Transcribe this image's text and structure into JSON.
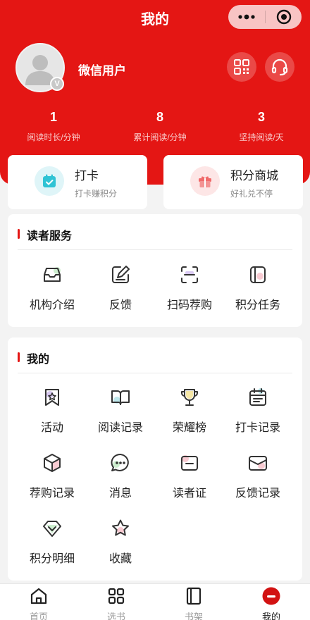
{
  "header": {
    "title": "我的"
  },
  "profile": {
    "username": "微信用户",
    "badge": "V"
  },
  "stats": [
    {
      "value": "1",
      "label": "阅读时长/分钟"
    },
    {
      "value": "8",
      "label": "累计阅读/分钟"
    },
    {
      "value": "3",
      "label": "坚持阅读/天"
    }
  ],
  "quick": {
    "checkin": {
      "title": "打卡",
      "subtitle": "打卡赚积分"
    },
    "mall": {
      "title": "积分商城",
      "subtitle": "好礼兑不停"
    }
  },
  "reader_services": {
    "title": "读者服务",
    "items": [
      {
        "label": "机构介绍",
        "icon": "inbox-icon"
      },
      {
        "label": "反馈",
        "icon": "edit-icon"
      },
      {
        "label": "扫码荐购",
        "icon": "scan-icon"
      },
      {
        "label": "积分任务",
        "icon": "task-icon"
      }
    ]
  },
  "mine": {
    "title": "我的",
    "items": [
      {
        "label": "活动",
        "icon": "activity-icon"
      },
      {
        "label": "阅读记录",
        "icon": "book-open-icon"
      },
      {
        "label": "荣耀榜",
        "icon": "trophy-icon"
      },
      {
        "label": "打卡记录",
        "icon": "calendar-icon"
      },
      {
        "label": "荐购记录",
        "icon": "box-icon"
      },
      {
        "label": "消息",
        "icon": "message-icon"
      },
      {
        "label": "读者证",
        "icon": "card-icon"
      },
      {
        "label": "反馈记录",
        "icon": "mail-icon"
      },
      {
        "label": "积分明细",
        "icon": "diamond-icon"
      },
      {
        "label": "收藏",
        "icon": "star-icon"
      }
    ]
  },
  "tabbar": [
    {
      "label": "首页",
      "icon": "home-icon"
    },
    {
      "label": "选书",
      "icon": "grid-icon"
    },
    {
      "label": "书架",
      "icon": "bookshelf-icon"
    },
    {
      "label": "我的",
      "icon": "profile-icon"
    }
  ],
  "colors": {
    "brand": "#e41614",
    "accent_blue": "#2fc3d4",
    "accent_pink": "#f06a6a"
  }
}
